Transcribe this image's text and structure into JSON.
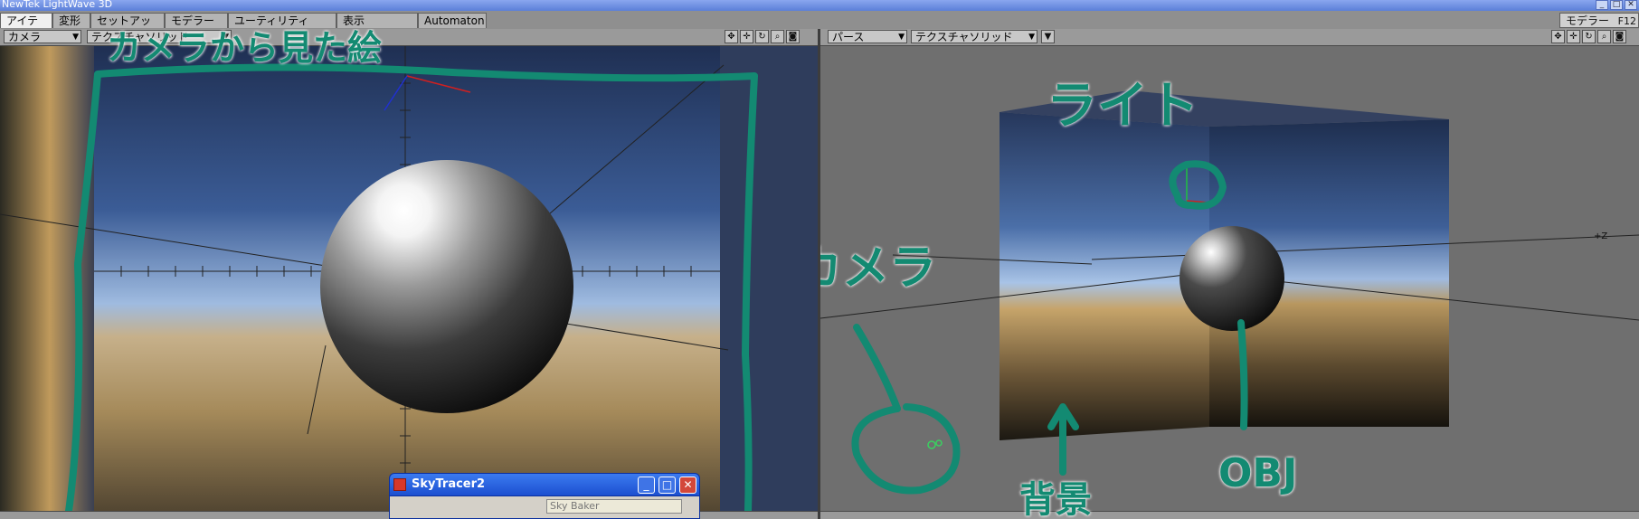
{
  "window": {
    "title": "NewTek LightWave 3D",
    "controls": [
      "_",
      "□",
      "✕"
    ]
  },
  "tabs": [
    {
      "label": "アイテム",
      "active": true
    },
    {
      "label": "変形",
      "active": false
    },
    {
      "label": "セットアップ",
      "active": false
    },
    {
      "label": "モデラー",
      "active": false
    },
    {
      "label": "ユーティリティ",
      "active": false
    },
    {
      "label": "表示",
      "active": false
    },
    {
      "label": "Automaton",
      "active": false
    }
  ],
  "mode_switch": {
    "label": "モデラー",
    "shortcut": "F12"
  },
  "left_viewport": {
    "view_select": "カメラ",
    "texture_select": "テクスチャソリッド"
  },
  "right_viewport": {
    "view_select": "パース",
    "texture_select": "テクスチャソリッド",
    "axis_label": "+Z"
  },
  "sky_tracer": {
    "title": "SkyTracer2",
    "body_label": "Sky Baker",
    "controls": {
      "minimize": "_",
      "maximize": "□",
      "close": "✕"
    }
  },
  "annotations": {
    "camera_view_note": "カメラから見た絵",
    "light_note": "ライト",
    "camera_note": "カメラ",
    "background_note": "背景",
    "object_note": "OBJ"
  },
  "colors": {
    "annotation_green": "#138a72",
    "sky_top": "#26375b",
    "sky_horizon": "#a8c3e6",
    "ground": "#c2a36a",
    "sphere_dark": "#1a1a1a"
  }
}
